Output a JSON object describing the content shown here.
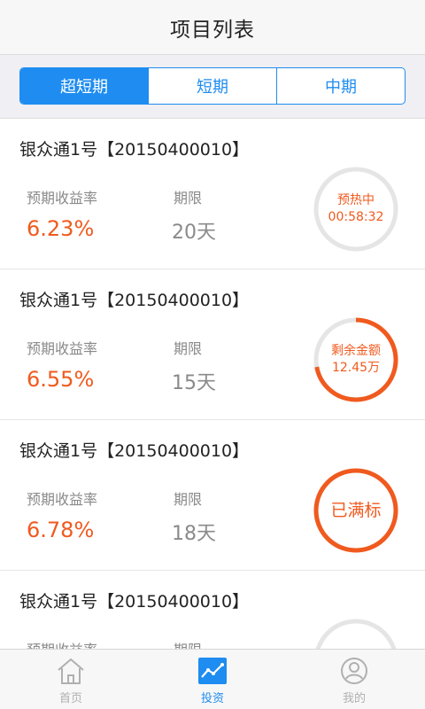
{
  "header": {
    "title": "项目列表"
  },
  "tabs": [
    {
      "label": "超短期",
      "active": true
    },
    {
      "label": "短期",
      "active": false
    },
    {
      "label": "中期",
      "active": false
    }
  ],
  "projects": [
    {
      "name": "银众通1号【20150400010】",
      "rate_label": "预期收益率",
      "rate": "6.23%",
      "term_label": "期限",
      "term": "20天",
      "status": "preheat",
      "status_lines": [
        "预热中",
        "00:58:32"
      ],
      "progress": 0
    },
    {
      "name": "银众通1号【20150400010】",
      "rate_label": "预期收益率",
      "rate": "6.55%",
      "term_label": "期限",
      "term": "15天",
      "status": "remaining",
      "status_lines": [
        "剩余金额",
        "12.45万"
      ],
      "progress": 0.72
    },
    {
      "name": "银众通1号【20150400010】",
      "rate_label": "预期收益率",
      "rate": "6.78%",
      "term_label": "期限",
      "term": "18天",
      "status": "full",
      "status_lines": [
        "已满标"
      ],
      "progress": 1.0
    },
    {
      "name": "银众通1号【20150400010】",
      "rate_label": "预期收益率",
      "rate": "",
      "term_label": "期限",
      "term": "",
      "status": "preheat",
      "status_lines": [],
      "progress": 0
    }
  ],
  "tabbar": [
    {
      "label": "首页",
      "icon": "home-icon",
      "active": false
    },
    {
      "label": "投资",
      "icon": "chart-icon",
      "active": true
    },
    {
      "label": "我的",
      "icon": "user-icon",
      "active": false
    }
  ],
  "colors": {
    "accent": "#1e8cf0",
    "highlight": "#f05a1e",
    "ring_track": "#e5e5e5"
  }
}
